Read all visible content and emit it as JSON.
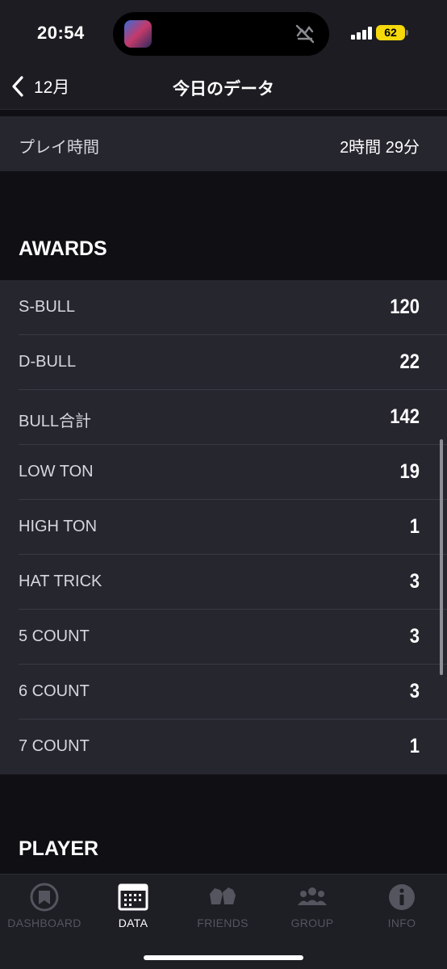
{
  "status_bar": {
    "time": "20:54",
    "battery": "62"
  },
  "nav": {
    "back_label": "12月",
    "title": "今日のデータ"
  },
  "play_time": {
    "label": "プレイ時間",
    "value": "2時間 29分"
  },
  "awards": {
    "title": "AWARDS",
    "rows": [
      {
        "label": "S-BULL",
        "value": "120"
      },
      {
        "label": "D-BULL",
        "value": "22"
      },
      {
        "label": "BULL合計",
        "value": "142"
      },
      {
        "label": "LOW TON",
        "value": "19"
      },
      {
        "label": "HIGH TON",
        "value": "1"
      },
      {
        "label": "HAT TRICK",
        "value": "3"
      },
      {
        "label": "5 COUNT",
        "value": "3"
      },
      {
        "label": "6 COUNT",
        "value": "3"
      },
      {
        "label": "7 COUNT",
        "value": "1"
      }
    ]
  },
  "player": {
    "title": "PLAYER"
  },
  "tab_bar": {
    "tabs": [
      {
        "label": "DASHBOARD",
        "icon": "dashboard-icon",
        "active": false
      },
      {
        "label": "DATA",
        "icon": "calendar-icon",
        "active": true
      },
      {
        "label": "FRIENDS",
        "icon": "friends-icon",
        "active": false
      },
      {
        "label": "GROUP",
        "icon": "group-icon",
        "active": false
      },
      {
        "label": "INFO",
        "icon": "info-icon",
        "active": false
      }
    ]
  },
  "colors": {
    "active_tab": "#ffffff",
    "inactive_tab": "#55555f",
    "battery": "#f5d90a"
  }
}
